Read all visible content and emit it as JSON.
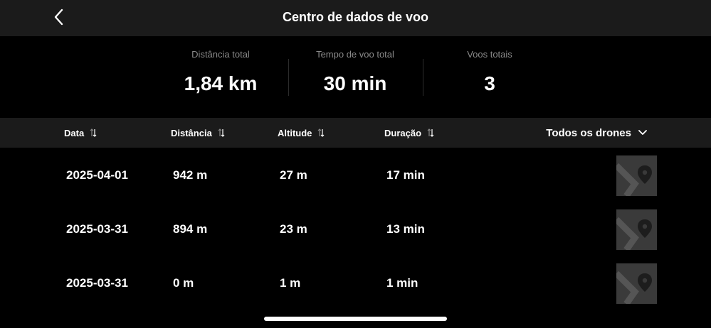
{
  "header": {
    "title": "Centro de dados de voo",
    "back_icon": "chevron-left-icon"
  },
  "summary": {
    "distance": {
      "label": "Distância total",
      "value": "1,84 km"
    },
    "time": {
      "label": "Tempo de voo total",
      "value": "30 min"
    },
    "flights": {
      "label": "Voos totais",
      "value": "3"
    }
  },
  "table": {
    "columns": {
      "date": "Data",
      "distance": "Distância",
      "altitude": "Altitude",
      "duration": "Duração"
    },
    "drone_filter": "Todos os drones",
    "rows": [
      {
        "date": "2025-04-01",
        "distance": "942 m",
        "altitude": "27 m",
        "duration": "17 min"
      },
      {
        "date": "2025-03-31",
        "distance": "894 m",
        "altitude": "23 m",
        "duration": "13 min"
      },
      {
        "date": "2025-03-31",
        "distance": "0 m",
        "altitude": "1 m",
        "duration": "1 min"
      }
    ]
  },
  "colors": {
    "background": "#000000",
    "bar": "#1b1b1b",
    "muted_text": "#8a8a8a",
    "thumbnail": "#3a3a3a"
  }
}
